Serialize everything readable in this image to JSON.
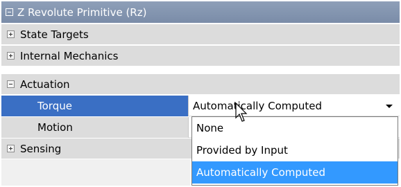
{
  "title": "Z Revolute Primitive (Rz)",
  "groups": {
    "state_targets": "State Targets",
    "internal_mechanics": "Internal Mechanics",
    "actuation": "Actuation",
    "sensing": "Sensing"
  },
  "properties": {
    "torque": {
      "label": "Torque",
      "value": "Automatically Computed"
    },
    "motion": {
      "label": "Motion",
      "value": ""
    }
  },
  "dropdown": {
    "options": [
      "None",
      "Provided by Input",
      "Automatically Computed"
    ],
    "selected": "Automatically Computed"
  },
  "colors": {
    "title_bar": "#8395b0",
    "selected_row": "#3a6fc4",
    "selected_option": "#3399ff"
  }
}
